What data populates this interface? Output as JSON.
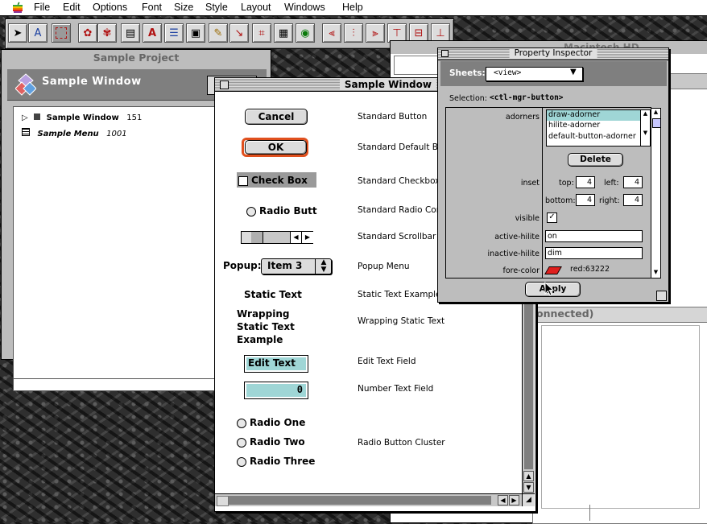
{
  "menubar": {
    "items": [
      "File",
      "Edit",
      "Options",
      "Font",
      "Size",
      "Style",
      "Layout",
      "Windows",
      "Help"
    ]
  },
  "project_window": {
    "title": "Sample Project",
    "header": "Sample Window",
    "items": [
      {
        "name": "Sample Window",
        "id": "151"
      },
      {
        "name": "Sample Menu",
        "id": "1001"
      }
    ]
  },
  "sample_window": {
    "title": "Sample Window",
    "cancel_label": "Cancel",
    "ok_label": "OK",
    "checkbox_label": "Check Box",
    "radio_label": "Radio Butt",
    "popup_label": "Popup:",
    "popup_value": "Item 3",
    "static_text": "Static Text",
    "wrapping_lines": [
      "Wrapping",
      "Static Text",
      "Example"
    ],
    "edit_text": "Edit Text",
    "number_value": "0",
    "radio_one": "Radio One",
    "radio_two": "Radio Two",
    "radio_three": "Radio Three",
    "descriptions": {
      "button": "Standard Button",
      "default_button": "Standard Default But",
      "checkbox": "Standard Checkbox C",
      "radio": "Standard Radio Contr",
      "scrollbar": "Standard Scrollbar",
      "popup": "Popup Menu",
      "static": "Static Text Example",
      "wrapping": "Wrapping Static Text",
      "edit": "Edit Text Field",
      "number": "Number Text Field",
      "cluster": "Radio Button Cluster"
    }
  },
  "machd_window": {
    "title": "Macintosh HD",
    "connected": "onnected)"
  },
  "inspector": {
    "title": "Property Inspector",
    "sheets_label": "Sheets:",
    "sheets_value": "<view>",
    "selection_label": "Selection:",
    "selection_value": "<ctl-mgr-button>",
    "adorners_label": "adorners",
    "adorner_items": [
      "draw-adorner",
      "hilite-adorner",
      "default-button-adorner"
    ],
    "delete_label": "Delete",
    "inset_label": "inset",
    "top_label": "top:",
    "top_value": "4",
    "left_label": "left:",
    "left_value": "4",
    "bottom_label": "bottom:",
    "bottom_value": "4",
    "right_label": "right:",
    "right_value": "4",
    "visible_label": "visible",
    "active_hilite_label": "active-hilite",
    "active_hilite_value": "on",
    "inactive_hilite_label": "inactive-hilite",
    "inactive_hilite_value": "dim",
    "fore_color_label": "fore-color",
    "fore_color_value": "red:63222",
    "apply_label": "Apply"
  },
  "colors": {
    "selection_teal": "#9fd6d6",
    "default_outline": "#e0501e",
    "swatch_red": "#e0201e"
  }
}
